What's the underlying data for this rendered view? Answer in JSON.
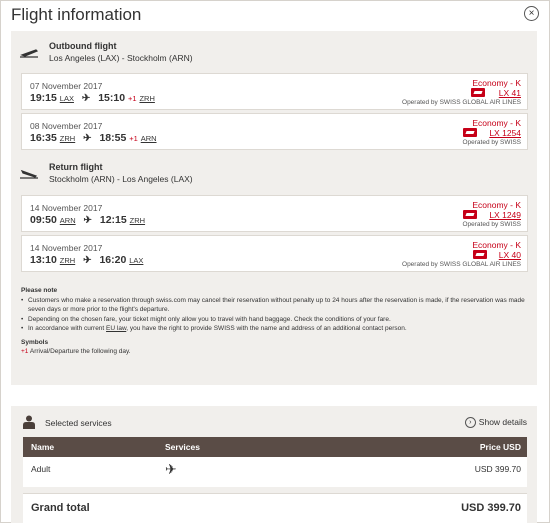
{
  "header": {
    "title": "Flight information",
    "close_label": "×"
  },
  "outbound": {
    "title": "Outbound flight",
    "route": "Los Angeles (LAX) - Stockholm (ARN)",
    "flights": [
      {
        "date": "07 November 2017",
        "dep_time": "19:15",
        "dep_ap": "LAX",
        "arr_time": "15:10",
        "plus": "+1",
        "arr_ap": "ZRH",
        "class": "Economy - K",
        "flight_no": "LX 41",
        "operated": "Operated by SWISS GLOBAL AIR LINES"
      },
      {
        "date": "08 November 2017",
        "dep_time": "16:35",
        "dep_ap": "ZRH",
        "arr_time": "18:55",
        "plus": "+1",
        "arr_ap": "ARN",
        "class": "Economy - K",
        "flight_no": "LX 1254",
        "operated": "Operated by SWISS"
      }
    ]
  },
  "return": {
    "title": "Return flight",
    "route": "Stockholm (ARN) - Los Angeles (LAX)",
    "flights": [
      {
        "date": "14 November 2017",
        "dep_time": "09:50",
        "dep_ap": "ARN",
        "arr_time": "12:15",
        "plus": "",
        "arr_ap": "ZRH",
        "class": "Economy - K",
        "flight_no": "LX 1249",
        "operated": "Operated by SWISS"
      },
      {
        "date": "14 November 2017",
        "dep_time": "13:10",
        "dep_ap": "ZRH",
        "arr_time": "16:20",
        "plus": "",
        "arr_ap": "LAX",
        "class": "Economy - K",
        "flight_no": "LX 40",
        "operated": "Operated by SWISS GLOBAL AIR LINES"
      }
    ]
  },
  "notes": {
    "heading": "Please note",
    "items": [
      "Customers who make a reservation through swiss.com may cancel their reservation without penalty up to 24 hours after the reservation is made, if the reservation was made seven days or more prior to the flight's departure.",
      "Depending on the chosen fare, your ticket might only allow you to travel with hand baggage. Check the conditions of your fare."
    ],
    "item3_pre": "In accordance with current ",
    "item3_link": "EU law",
    "item3_post": ", you have the right to provide SWISS with the name and address of an additional contact person.",
    "symbols_heading": "Symbols",
    "symbol_mark": "+1",
    "symbol_text": "Arrival/Departure the following day."
  },
  "services": {
    "title": "Selected services",
    "show_details": "Show details",
    "columns": {
      "name": "Name",
      "services": "Services",
      "price": "Price USD"
    },
    "row": {
      "name": "Adult",
      "price": "USD 399.70"
    },
    "total_label": "Grand total",
    "total_value": "USD  399.70"
  },
  "icons": {
    "plane": "plane-icon",
    "person": "person-icon",
    "info": "info-circle-icon"
  },
  "colors": {
    "accent": "#c60018",
    "table_header": "#5a4c46",
    "panel": "#f1efec"
  }
}
